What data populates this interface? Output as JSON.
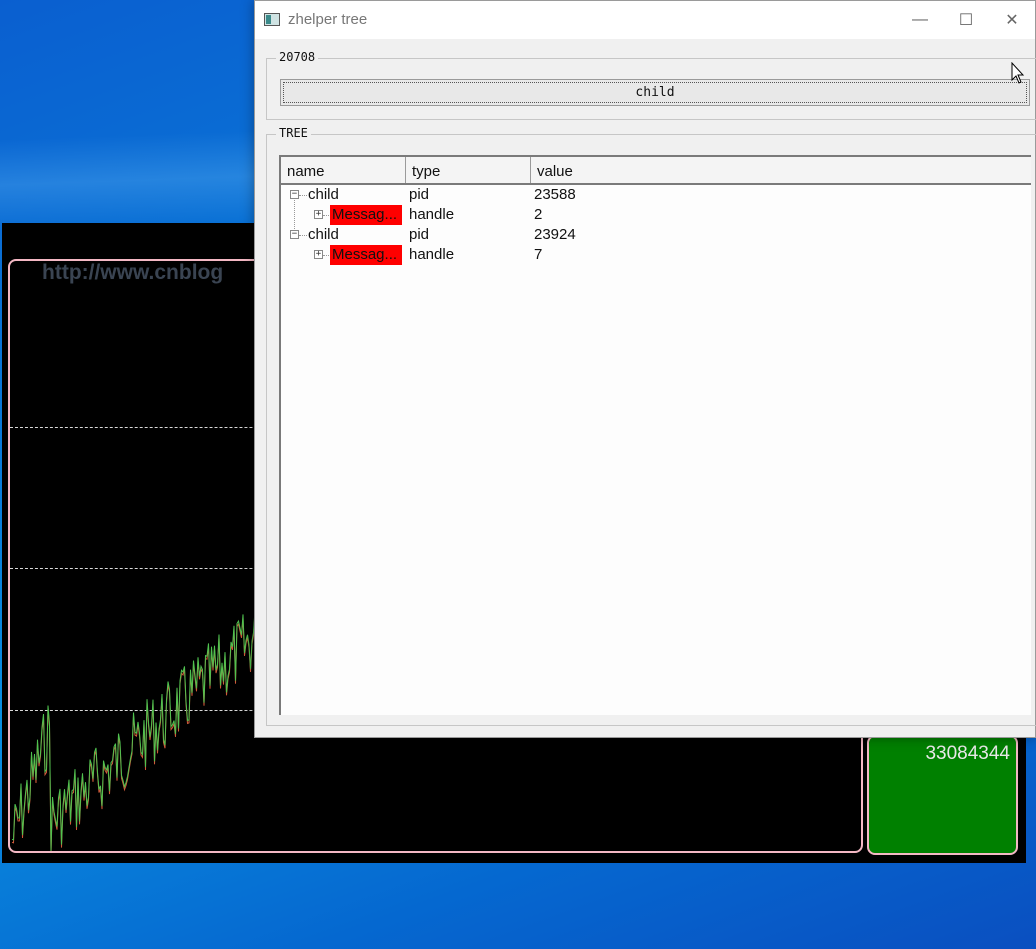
{
  "background_window": {
    "watermark": "http://www.cnblog",
    "counter": "33084344"
  },
  "window": {
    "title": "zhelper tree",
    "controls": {
      "minimize": "—",
      "maximize": "☐",
      "close": "✕"
    },
    "group_top_label": "20708",
    "child_button": "child",
    "group_tree_label": "TREE",
    "columns": [
      "name",
      "type",
      "value"
    ],
    "rows": [
      {
        "name": "child",
        "type": "pid",
        "value": "23588"
      },
      {
        "name": "Messag...",
        "type": "handle",
        "value": "2"
      },
      {
        "name": "child",
        "type": "pid",
        "value": "23924"
      },
      {
        "name": "Messag...",
        "type": "handle",
        "value": "7"
      }
    ]
  },
  "colors": {
    "desktop": "#0a7ad8",
    "chart_bg": "#000000",
    "chart_frame": "#f4b8c4",
    "counter_box": "#008000",
    "highlight": "#ff0000"
  }
}
